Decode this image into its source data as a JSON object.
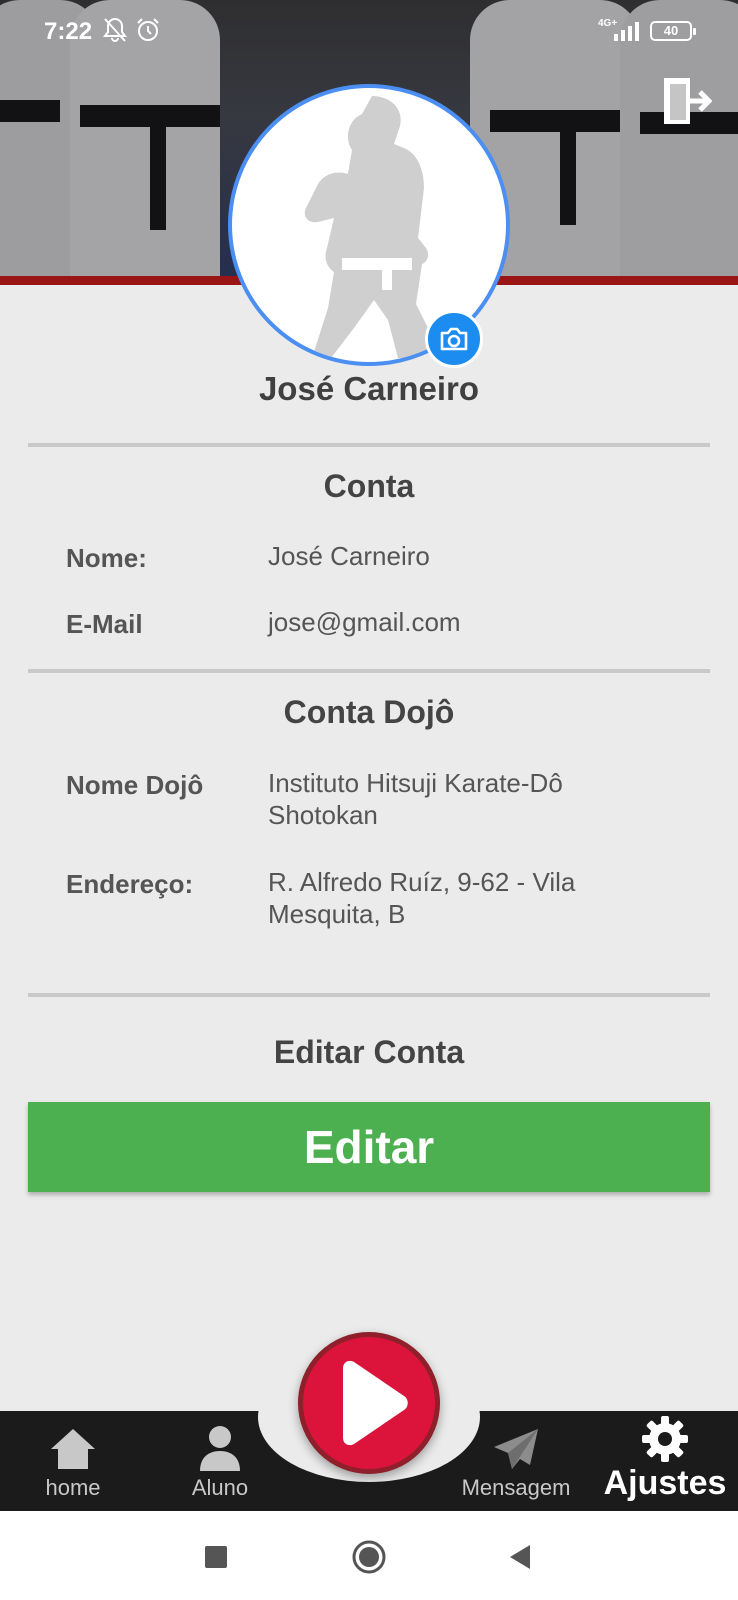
{
  "status_bar": {
    "time": "7:22",
    "network": "4G+",
    "battery": "40",
    "icons": [
      "bell-off-icon",
      "alarm-icon",
      "signal-icon",
      "battery-icon"
    ]
  },
  "header": {
    "logout_icon": "logout-door-icon",
    "avatar_icon": "karate-silhouette-icon",
    "camera_icon": "camera-icon"
  },
  "profile": {
    "name": "José Carneiro"
  },
  "account": {
    "title": "Conta",
    "name_label": "Nome:",
    "name_value": "José Carneiro",
    "email_label": "E-Mail",
    "email_value": "jose@gmail.com"
  },
  "dojo": {
    "title": "Conta Dojô",
    "name_label": "Nome Dojô",
    "name_value": "Instituto Hitsuji Karate-Dô Shotokan",
    "address_label": "Endereço:",
    "address_value": "R. Alfredo Ruíz, 9-62 - Vila Mesquita, B"
  },
  "edit": {
    "title": "Editar Conta",
    "button_label": "Editar",
    "button_color": "#4caf50"
  },
  "bottom_nav": {
    "items": [
      {
        "label": "home",
        "icon": "home-icon"
      },
      {
        "label": "Aluno",
        "icon": "person-icon"
      },
      {
        "label": "Mensagem",
        "icon": "paper-plane-icon"
      },
      {
        "label": "Ajustes",
        "icon": "gear-icon",
        "active": true
      }
    ],
    "center_icon": "play-icon",
    "center_color": "#dc143c"
  },
  "system_nav": {
    "icons": [
      "recents-square-icon",
      "home-circle-icon",
      "back-triangle-icon"
    ]
  }
}
